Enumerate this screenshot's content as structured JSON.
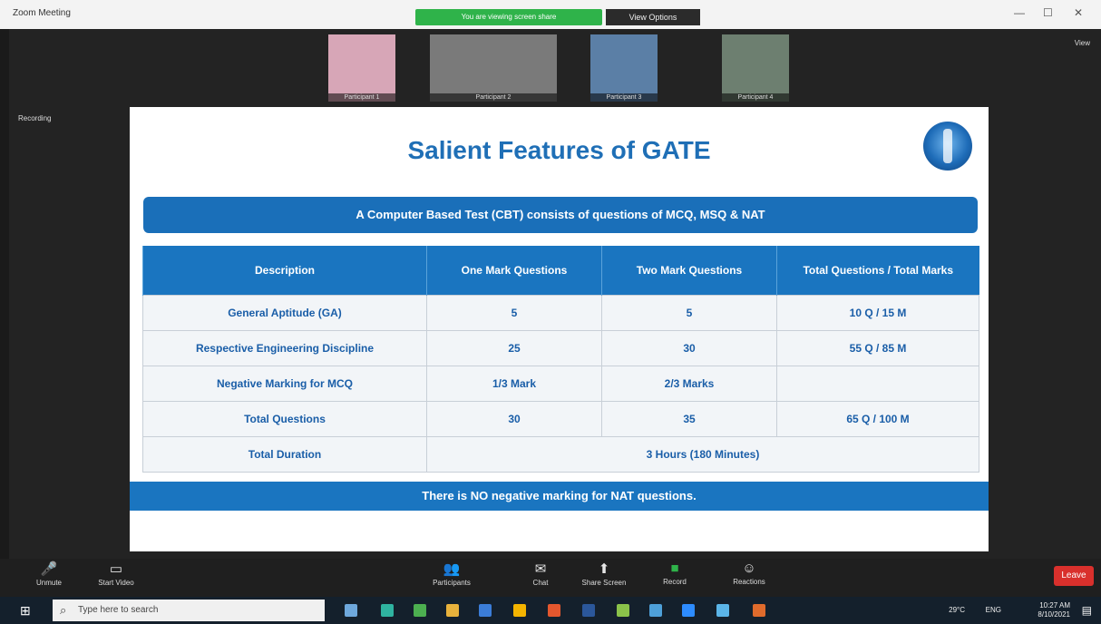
{
  "titlebar": {
    "app_name": "Zoom Meeting",
    "minimize": "—",
    "maximize": "☐",
    "close": "✕"
  },
  "share_banner": "You are viewing screen share",
  "view_options": "View Options",
  "participants": [
    {
      "name": "Participant 1"
    },
    {
      "name": "Participant 2"
    },
    {
      "name": "Participant 3"
    },
    {
      "name": "Participant 4"
    }
  ],
  "side_label": "Recording",
  "top_right_label": "View",
  "slide": {
    "title": "Salient Features of GATE",
    "subtitle": "A Computer Based Test (CBT) consists of questions of MCQ, MSQ & NAT",
    "columns": [
      "Description",
      "One Mark Questions",
      "Two Mark Questions",
      "Total Questions / Total Marks"
    ],
    "rows": [
      [
        "General Aptitude (GA)",
        "5",
        "5",
        "10 Q / 15 M"
      ],
      [
        "Respective Engineering Discipline",
        "25",
        "30",
        "55 Q / 85 M"
      ],
      [
        "Negative Marking for MCQ",
        "1/3 Mark",
        "2/3 Marks",
        ""
      ],
      [
        "Total Questions",
        "30",
        "35",
        "65 Q / 100 M"
      ]
    ],
    "duration_label": "Total Duration",
    "duration_value": "3 Hours (180 Minutes)",
    "note": "There is NO negative marking for NAT questions."
  },
  "controls": {
    "mute": "Unmute",
    "video": "Start Video",
    "participants": "Participants",
    "chat": "Chat",
    "share": "Share Screen",
    "record": "Record",
    "reactions": "Reactions",
    "leave": "Leave"
  },
  "taskbar": {
    "search_placeholder": "Type here to search",
    "weather": "29°C",
    "lang": "ENG",
    "time": "10:27 AM",
    "date": "8/10/2021"
  },
  "colors": {
    "accent_blue": "#1a75c0",
    "green": "#2fb34a",
    "leave_red": "#d9302c"
  }
}
